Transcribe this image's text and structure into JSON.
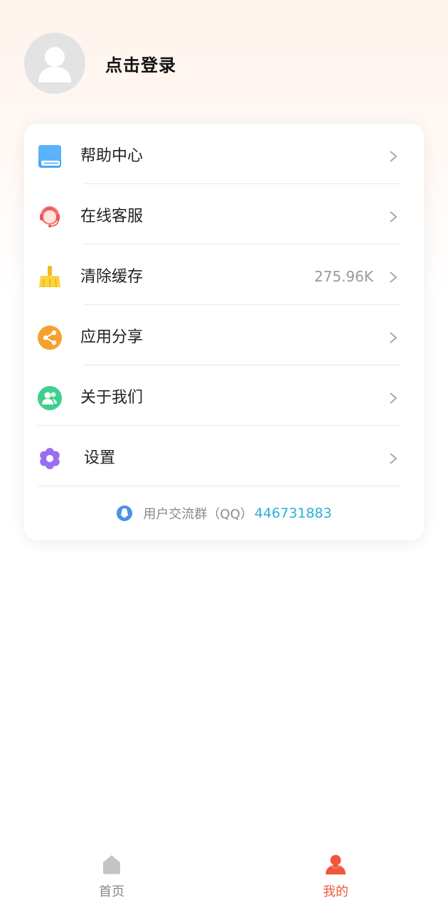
{
  "profile": {
    "login_text": "点击登录"
  },
  "menu": [
    {
      "label": "帮助中心",
      "value": "",
      "icon": "book-icon"
    },
    {
      "label": "在线客服",
      "value": "",
      "icon": "headset-icon"
    },
    {
      "label": "清除缓存",
      "value": "275.96K",
      "icon": "broom-icon"
    },
    {
      "label": "应用分享",
      "value": "",
      "icon": "share-icon"
    },
    {
      "label": "关于我们",
      "value": "",
      "icon": "people-icon"
    },
    {
      "label": "设置",
      "value": "",
      "icon": "gear-icon"
    }
  ],
  "qq_group": {
    "label": "用户交流群（QQ）",
    "number": "446731883",
    "icon": "qq-icon"
  },
  "tabbar": {
    "tabs": [
      {
        "label": "首页",
        "icon": "home-icon",
        "active": false
      },
      {
        "label": "我的",
        "icon": "user-icon",
        "active": true
      }
    ]
  },
  "colors": {
    "accent": "#f0573e",
    "link": "#2ab0d8",
    "help_icon": "#3e9ff0",
    "service_icon": "#f06a6a",
    "cache_icon": "#f8c62c",
    "share_icon": "#f5a22d",
    "about_icon": "#3fcf8e",
    "settings_icon": "#9a6ef0"
  }
}
